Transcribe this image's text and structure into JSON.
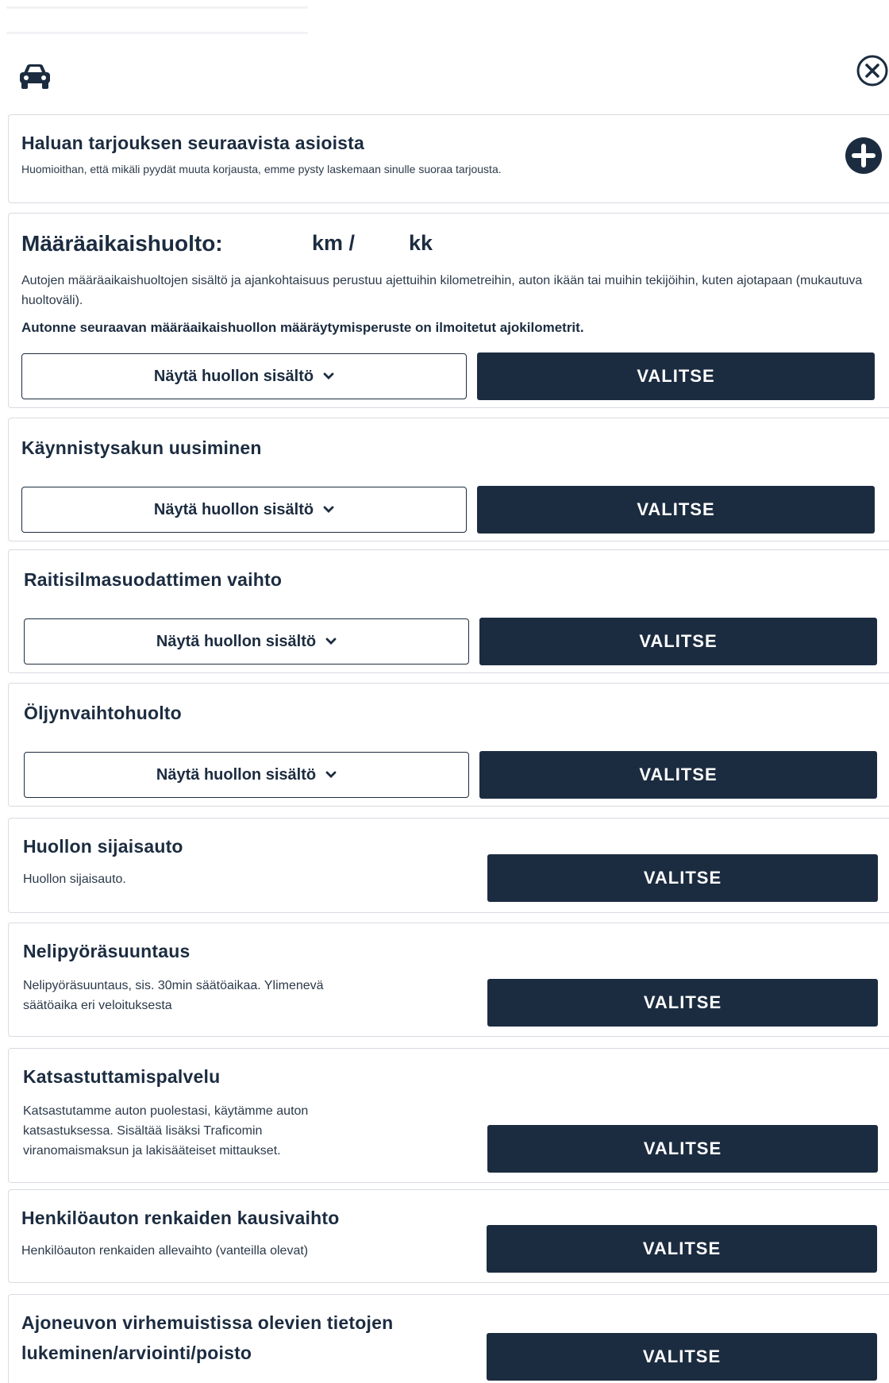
{
  "header": {
    "car_icon": "car-icon",
    "close_icon": "close-circle-icon"
  },
  "offer": {
    "title": "Haluan tarjouksen seuraavista asioista",
    "note": "Huomioithan, että mikäli pyydät muuta korjausta, emme pysty laskemaan sinulle suoraa tarjousta.",
    "add_icon": "plus-circle-icon"
  },
  "periodic": {
    "title": "Määräaikaishuolto:",
    "km_label": "km /",
    "kk_label": "kk",
    "desc": "Autojen määräaikaishuoltojen sisältö ja ajankohtaisuus perustuu ajettuihin kilometreihin, auton ikään tai muihin tekijöihin, kuten ajotapaan (mukautuva huoltoväli).",
    "basis": "Autonne seuraavan määräaikaishuollon määräytymisperuste on ilmoitetut ajokilometrit.",
    "show_label": "Näytä huollon sisältö",
    "select_label": "VALITSE"
  },
  "services": [
    {
      "title": "Käynnistysakun uusiminen",
      "show_label": "Näytä huollon sisältö",
      "select_label": "VALITSE"
    },
    {
      "title": "Raitisilmasuodattimen vaihto",
      "show_label": "Näytä huollon sisältö",
      "select_label": "VALITSE"
    },
    {
      "title": "Öljynvaihtohuolto",
      "show_label": "Näytä huollon sisältö",
      "select_label": "VALITSE"
    },
    {
      "title": "Huollon sijaisauto",
      "desc": "Huollon sijaisauto.",
      "select_label": "VALITSE"
    },
    {
      "title": "Nelipyöräsuuntaus",
      "desc_1": "Nelipyöräsuuntaus, sis. 30min säätöaikaa. Ylimenevä",
      "desc_2": "säätöaika eri veloituksesta",
      "select_label": "VALITSE"
    },
    {
      "title": "Katsastuttamispalvelu",
      "desc_1": "Katsastutamme auton puolestasi, käytämme auton",
      "desc_2": "katsastuksessa. Sisältää lisäksi Traficomin",
      "desc_3": "viranomaismaksun ja lakisääteiset mittaukset.",
      "select_label": "VALITSE"
    },
    {
      "title": "Henkilöauton renkaiden kausivaihto",
      "desc": "Henkilöauton renkaiden allevaihto (vanteilla olevat)",
      "select_label": "VALITSE"
    },
    {
      "title_1": "Ajoneuvon virhemuistissa olevien tietojen",
      "title_2": "lukeminen/arviointi/poisto",
      "select_label": "VALITSE"
    }
  ],
  "colors": {
    "primary": "#1c2c40",
    "border": "#d7dbe0",
    "background": "#ffffff"
  }
}
